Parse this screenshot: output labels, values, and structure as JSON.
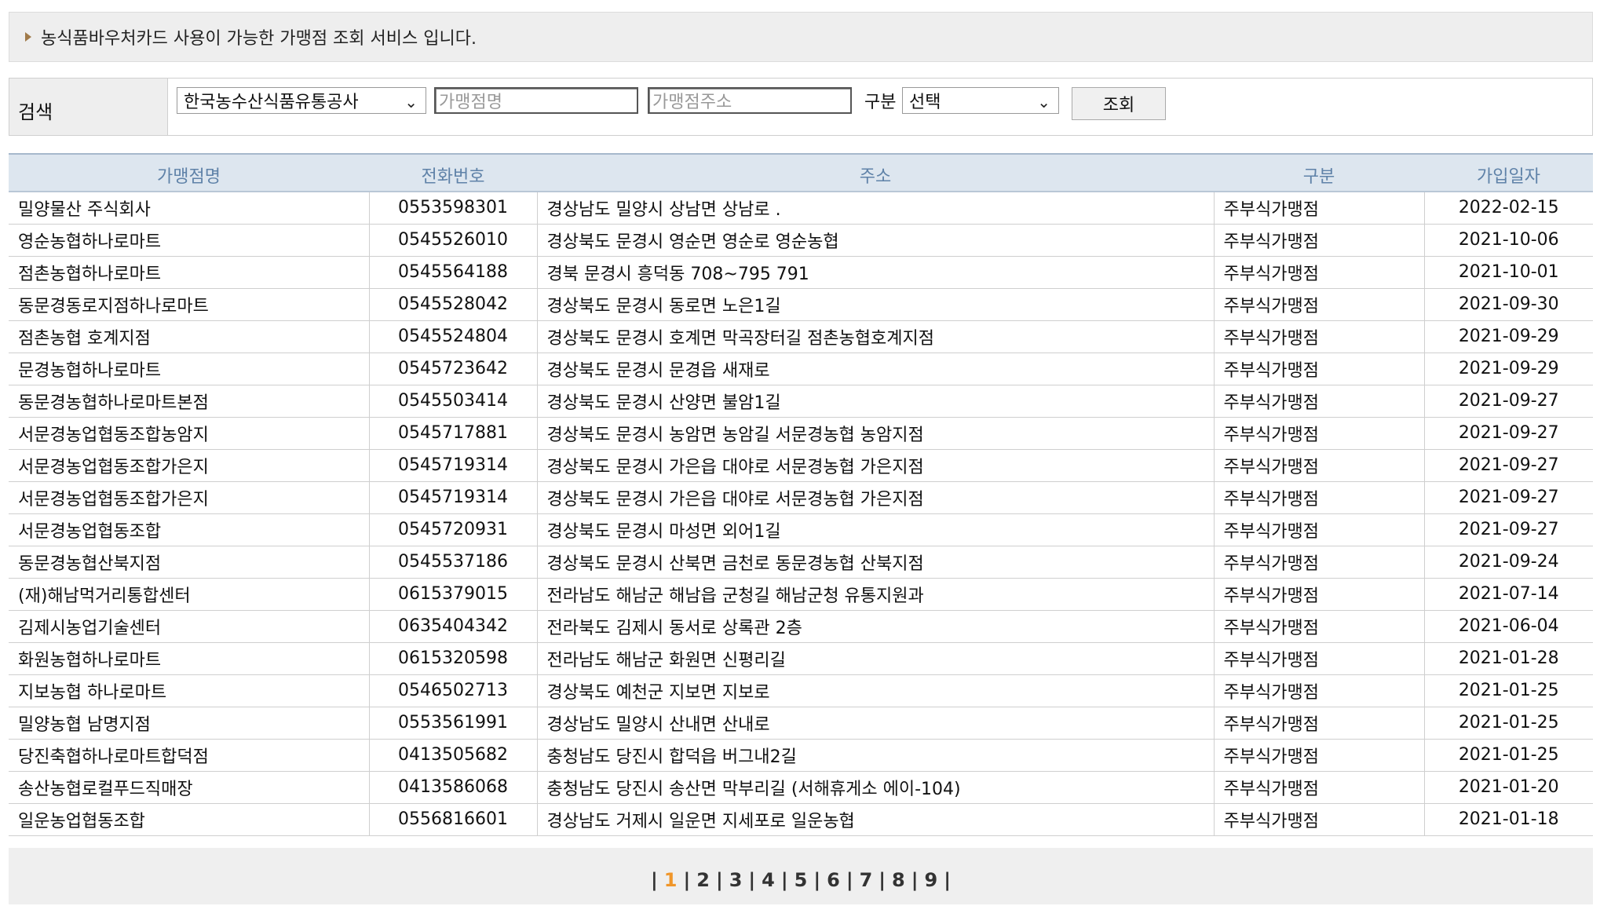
{
  "notice": {
    "text": "농식품바우처카드 사용이 가능한 가맹점 조회 서비스 입니다."
  },
  "search": {
    "label": "검색",
    "agency_selected": "한국농수산식품유통공사",
    "name_placeholder": "가맹점명",
    "address_placeholder": "가맹점주소",
    "type_label": "구분",
    "type_selected": "선택",
    "submit_label": "조회"
  },
  "table": {
    "headers": [
      "가맹점명",
      "전화번호",
      "주소",
      "구분",
      "가입일자"
    ],
    "rows": [
      [
        "밀양물산 주식회사",
        "0553598301",
        "경상남도 밀양시 상남면 상남로 .",
        "주부식가맹점",
        "2022-02-15"
      ],
      [
        "영순농협하나로마트",
        "0545526010",
        "경상북도 문경시 영순면 영순로 영순농협",
        "주부식가맹점",
        "2021-10-06"
      ],
      [
        "점촌농협하나로마트",
        "0545564188",
        "경북 문경시 흥덕동 708~795 791",
        "주부식가맹점",
        "2021-10-01"
      ],
      [
        "동문경동로지점하나로마트",
        "0545528042",
        "경상북도 문경시 동로면 노은1길",
        "주부식가맹점",
        "2021-09-30"
      ],
      [
        "점촌농협 호계지점",
        "0545524804",
        "경상북도 문경시 호계면 막곡장터길 점촌농협호계지점",
        "주부식가맹점",
        "2021-09-29"
      ],
      [
        "문경농협하나로마트",
        "0545723642",
        "경상북도 문경시 문경읍 새재로",
        "주부식가맹점",
        "2021-09-29"
      ],
      [
        "동문경농협하나로마트본점",
        "0545503414",
        "경상북도 문경시 산양면 불암1길",
        "주부식가맹점",
        "2021-09-27"
      ],
      [
        "서문경농업협동조합농암지",
        "0545717881",
        "경상북도 문경시 농암면 농암길 서문경농협 농암지점",
        "주부식가맹점",
        "2021-09-27"
      ],
      [
        "서문경농업협동조합가은지",
        "0545719314",
        "경상북도 문경시 가은읍 대야로 서문경농협 가은지점",
        "주부식가맹점",
        "2021-09-27"
      ],
      [
        "서문경농업협동조합가은지",
        "0545719314",
        "경상북도 문경시 가은읍 대야로 서문경농협 가은지점",
        "주부식가맹점",
        "2021-09-27"
      ],
      [
        "서문경농업협동조합",
        "0545720931",
        "경상북도 문경시 마성면 외어1길",
        "주부식가맹점",
        "2021-09-27"
      ],
      [
        "동문경농협산북지점",
        "0545537186",
        "경상북도 문경시 산북면 금천로 동문경농협 산북지점",
        "주부식가맹점",
        "2021-09-24"
      ],
      [
        "(재)해남먹거리통합센터",
        "0615379015",
        "전라남도 해남군 해남읍 군청길 해남군청 유통지원과",
        "주부식가맹점",
        "2021-07-14"
      ],
      [
        "김제시농업기술센터",
        "0635404342",
        "전라북도 김제시 동서로 상록관 2층",
        "주부식가맹점",
        "2021-06-04"
      ],
      [
        "화원농협하나로마트",
        "0615320598",
        "전라남도 해남군 화원면 신평리길",
        "주부식가맹점",
        "2021-01-28"
      ],
      [
        "지보농협 하나로마트",
        "0546502713",
        "경상북도 예천군 지보면 지보로",
        "주부식가맹점",
        "2021-01-25"
      ],
      [
        "밀양농협 남명지점",
        "0553561991",
        "경상남도 밀양시 산내면 산내로",
        "주부식가맹점",
        "2021-01-25"
      ],
      [
        "당진축협하나로마트합덕점",
        "0413505682",
        "충청남도 당진시 합덕읍 버그내2길",
        "주부식가맹점",
        "2021-01-25"
      ],
      [
        "송산농협로컬푸드직매장",
        "0413586068",
        "충청남도 당진시 송산면 막부리길 (서해휴게소 에이-104)",
        "주부식가맹점",
        "2021-01-20"
      ],
      [
        "일운농업협동조합",
        "0556816601",
        "경상남도 거제시 일운면 지세포로 일운농협",
        "주부식가맹점",
        "2021-01-18"
      ]
    ]
  },
  "pagination": {
    "pages": [
      "1",
      "2",
      "3",
      "4",
      "5",
      "6",
      "7",
      "8",
      "9"
    ],
    "current": "1"
  }
}
